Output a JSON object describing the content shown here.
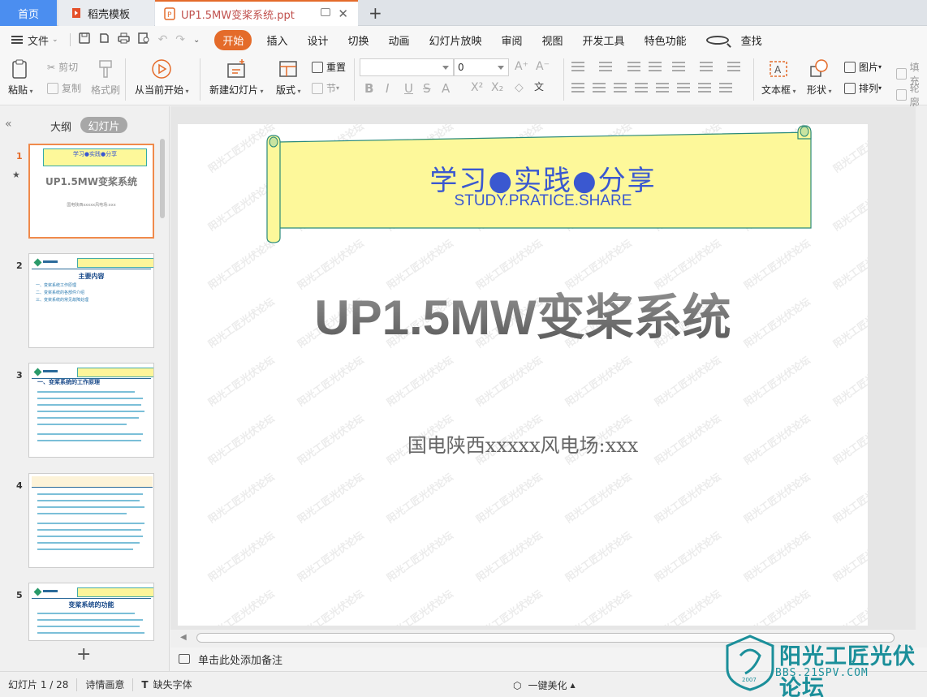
{
  "tabs": {
    "home": "首页",
    "template": "稻壳模板",
    "document": "UP1.5MW变桨系统.ppt",
    "add": "+"
  },
  "menu": {
    "file": "文件",
    "items": [
      "开始",
      "插入",
      "设计",
      "切换",
      "动画",
      "幻灯片放映",
      "审阅",
      "视图",
      "开发工具",
      "特色功能"
    ],
    "search": "查找"
  },
  "ribbon": {
    "paste": "粘贴",
    "cut": "剪切",
    "copy": "复制",
    "format_painter": "格式刷",
    "play_from_current": "从当前开始",
    "new_slide": "新建幻灯片",
    "layout": "版式",
    "reset": "重置",
    "section": "节",
    "font_size": "0",
    "textbox": "文本框",
    "shape": "形状",
    "picture": "图片",
    "arrange": "排列",
    "fill": "填充",
    "outline": "轮廓"
  },
  "left_panel": {
    "outline_tab": "大纲",
    "slides_tab": "幻灯片",
    "slide_numbers": [
      "1",
      "2",
      "3",
      "4",
      "5"
    ],
    "thumb1_banner": "学习●实践●分享",
    "thumb1_title": "UP1.5MW变桨系统",
    "thumb1_sub": "国电陕西xxxxx风电场:xxx",
    "thumb2_title": "主要内容",
    "thumb2_items": [
      "一、变桨系统工作原理",
      "二、变桨系统的各部件介绍",
      "三、变桨系统的常见故障处理"
    ],
    "thumb3_title": "一、变桨系统的工作原理",
    "thumb5_title": "变桨系统的功能"
  },
  "slide": {
    "banner_main": "学习●实践●分享",
    "banner_sub": "STUDY.PRATICE.SHARE",
    "title": "UP1.5MW变桨系统",
    "subtitle": "国电陕西xxxxx风电场:xxx",
    "watermark": "阳光工匠光伏论坛"
  },
  "notes": {
    "placeholder": "单击此处添加备注"
  },
  "status": {
    "slide_counter": "幻灯片 1 / 28",
    "theme": "诗情画意",
    "missing_font": "缺失字体",
    "beautify": "一键美化"
  },
  "site_logo": {
    "name": "阳光工匠光伏论坛",
    "url": "BBS.21SPV.COM",
    "year": "2007"
  },
  "colors": {
    "accent": "#e46b2a",
    "tab_home": "#4b8ef0",
    "banner_fill": "#fdf89a",
    "banner_text": "#3a58d0",
    "logo": "#1b8f9a"
  }
}
